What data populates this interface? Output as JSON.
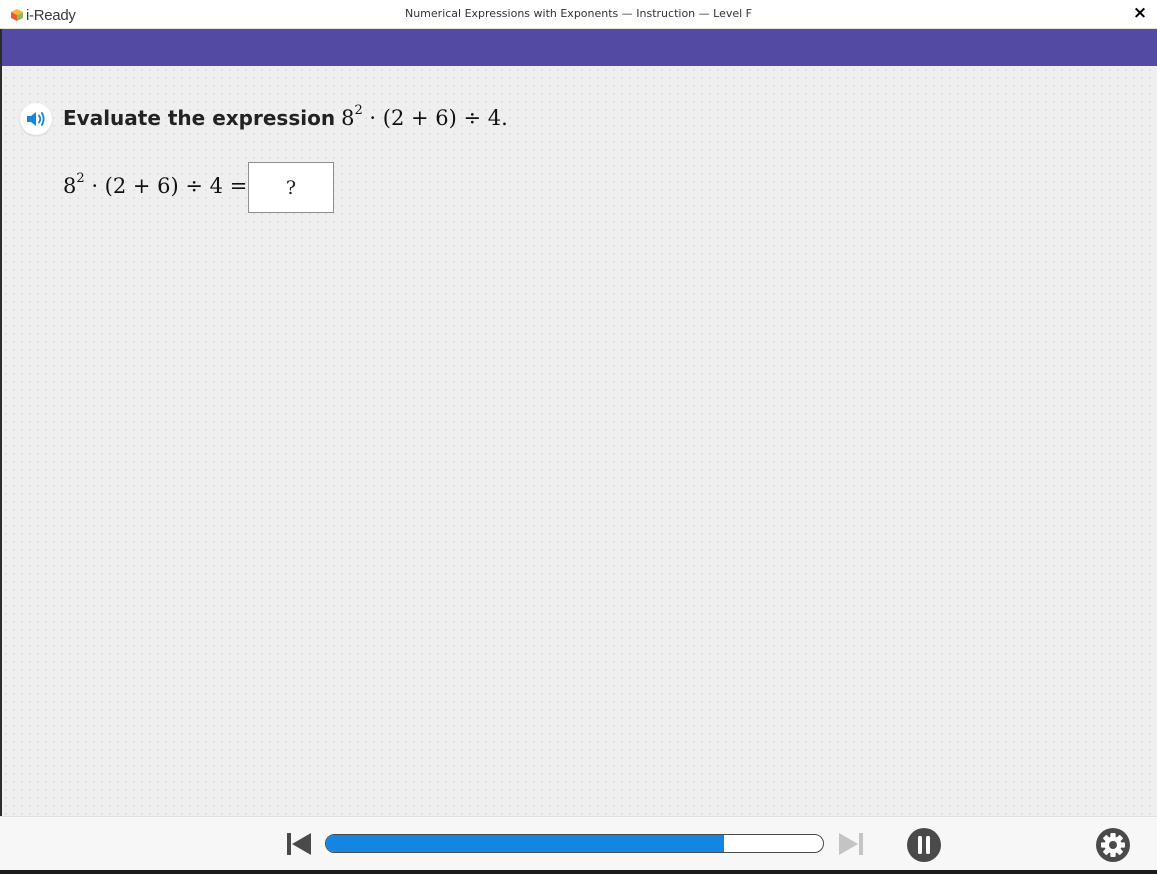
{
  "app": {
    "logo_text": "i-Ready",
    "window_title": "Numerical Expressions with Exponents — Instruction — Level F",
    "close_label": "×"
  },
  "prompt": {
    "text": "Evaluate the expression",
    "expression": {
      "base": "8",
      "exponent": "2",
      "rest": " · (2 + 6) ÷ 4.",
      "rest_display": "·(2+6)÷4."
    }
  },
  "equation": {
    "base": "8",
    "exponent": "2",
    "rest": " · (2 + 6) ÷ 4 =",
    "answer_placeholder": "?"
  },
  "player": {
    "progress": 0.8,
    "icons": [
      "skip-back-icon",
      "skip-forward-icon",
      "pause-icon",
      "settings-gear-icon",
      "speaker-icon"
    ]
  },
  "colors": {
    "header_band": "#534ba3",
    "progress_fill": "#1585e2",
    "audio_icon": "#1585e2",
    "controls": "#4a4a4a"
  }
}
